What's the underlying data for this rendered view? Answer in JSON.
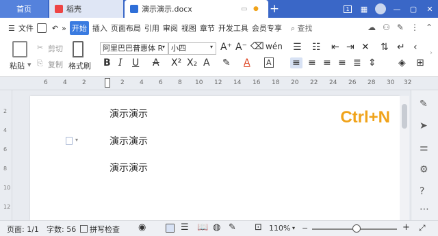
{
  "tabs": {
    "home": "首页",
    "daoke": "稻壳",
    "document": "演示演示.docx"
  },
  "window": {
    "page_count_badge": "1"
  },
  "menu": {
    "file": "文件",
    "items": [
      "开始",
      "插入",
      "页面布局",
      "引用",
      "审阅",
      "视图",
      "章节",
      "开发工具",
      "会员专享"
    ],
    "search": "查找"
  },
  "ribbon": {
    "paste": "粘贴",
    "cut": "剪切",
    "copy": "复制",
    "format_painter": "格式刷",
    "font_name": "阿里巴巴普惠体 R",
    "font_size": "小四"
  },
  "document": {
    "lines": [
      "演示演示",
      "演示演示",
      "演示演示"
    ],
    "shortcut": "Ctrl+N"
  },
  "status": {
    "page": "页面: 1/1",
    "word_count": "字数: 56",
    "spell_check": "拼写检查",
    "zoom": "110%"
  },
  "colors": {
    "title_bar": "#3a67c7",
    "active_menu": "#3a7be0",
    "shortcut_text": "#f0a31a"
  }
}
